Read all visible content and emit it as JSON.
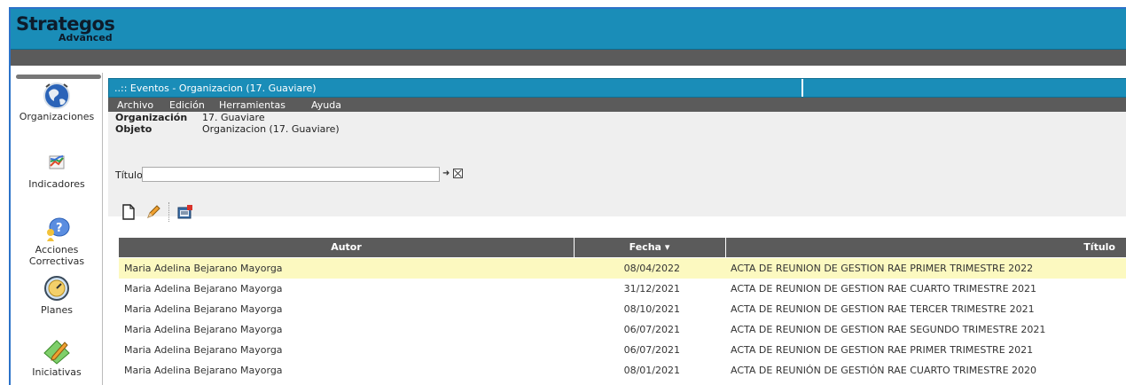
{
  "app": {
    "name": "Strategos",
    "edition": "Advanced"
  },
  "sidebar": {
    "items": [
      {
        "label": "Organizaciones",
        "icon": "globe-icon"
      },
      {
        "label": "Indicadores",
        "icon": "chart-icon"
      },
      {
        "label": "Acciones Correctivas",
        "icon": "person-question-icon"
      },
      {
        "label": "Planes",
        "icon": "compass-icon"
      },
      {
        "label": "Iniciativas",
        "icon": "pencil-diamond-icon"
      }
    ]
  },
  "panel": {
    "title": "..:: Eventos - Organizacion (17. Guaviare)",
    "menu": [
      "Archivo",
      "Edición",
      "Herramientas",
      "Ayuda"
    ],
    "info": {
      "organizacion_label": "Organización",
      "organizacion_value": "17. Guaviare",
      "objeto_label": "Objeto",
      "objeto_value": "Organizacion (17. Guaviare)"
    },
    "filter": {
      "label": "Título",
      "value": "",
      "go_icon": "arrow-right-icon",
      "clear_icon": "clear-box-icon"
    },
    "toolbar": [
      "new-document-icon",
      "edit-pencil-icon",
      "manage-calendar-icon"
    ]
  },
  "table": {
    "columns": {
      "autor": "Autor",
      "fecha": "Fecha",
      "fecha_sort": "▾",
      "titulo": "Título"
    },
    "rows": [
      {
        "autor": "Maria Adelina Bejarano Mayorga",
        "fecha": "08/04/2022",
        "titulo": "ACTA DE REUNION DE GESTION RAE PRIMER TRIMESTRE 2022"
      },
      {
        "autor": "Maria Adelina Bejarano Mayorga",
        "fecha": "31/12/2021",
        "titulo": "ACTA DE REUNION DE GESTION RAE CUARTO TRIMESTRE 2021"
      },
      {
        "autor": "Maria Adelina Bejarano Mayorga",
        "fecha": "08/10/2021",
        "titulo": "ACTA DE REUNION DE GESTION RAE TERCER TRIMESTRE 2021"
      },
      {
        "autor": "Maria Adelina Bejarano Mayorga",
        "fecha": "06/07/2021",
        "titulo": "ACTA DE REUNION DE GESTION RAE SEGUNDO TRIMESTRE 2021"
      },
      {
        "autor": "Maria Adelina Bejarano Mayorga",
        "fecha": "06/07/2021",
        "titulo": "ACTA DE REUNION DE GESTION RAE PRIMER TRIMESTRE 2021"
      },
      {
        "autor": "Maria Adelina Bejarano Mayorga",
        "fecha": "08/01/2021",
        "titulo": "ACTA DE REUNIÓN DE GESTIÓN RAE CUARTO TRIMESTRE 2020"
      }
    ]
  },
  "colors": {
    "brand_blue": "#1a8db8",
    "bar_gray": "#5b5b5b",
    "selected_row": "#fcf9c0"
  }
}
